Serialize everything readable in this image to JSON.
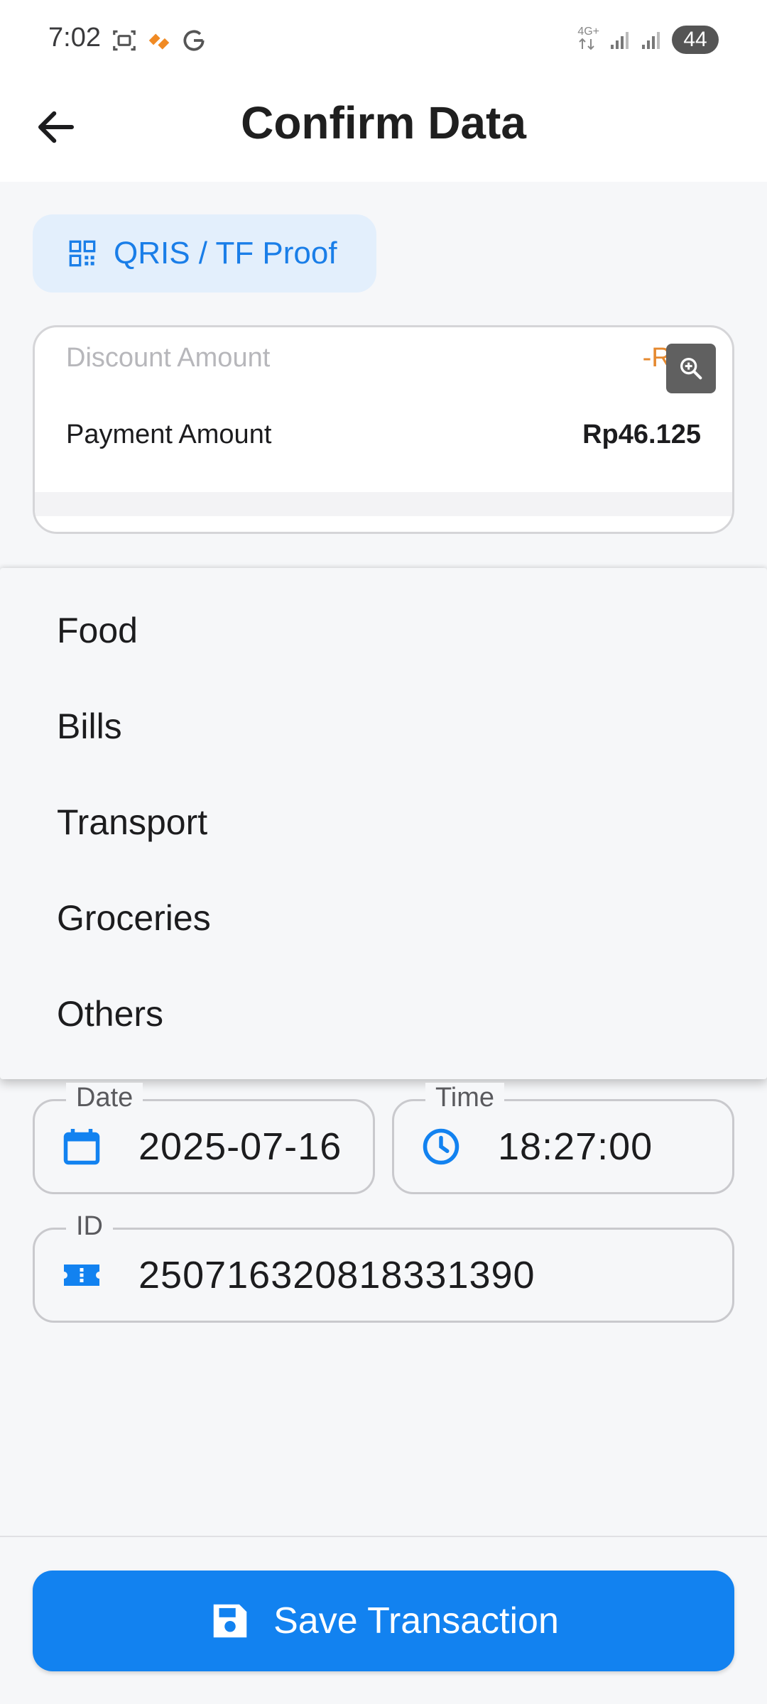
{
  "status_bar": {
    "time": "7:02",
    "network": "4G+",
    "battery": "44"
  },
  "app_bar": {
    "title": "Confirm Data"
  },
  "qris_chip": {
    "label": "QRIS / TF Proof"
  },
  "amount_card": {
    "discount_label": "Discount Amount",
    "discount_value": "-Rp5",
    "payment_label": "Payment Amount",
    "payment_value": "Rp46.125"
  },
  "category_menu": {
    "items": [
      "Food",
      "Bills",
      "Transport",
      "Groceries",
      "Others"
    ]
  },
  "fields": {
    "date": {
      "label": "Date",
      "value": "2025-07-16"
    },
    "time": {
      "label": "Time",
      "value": "18:27:00"
    },
    "id": {
      "label": "ID",
      "value": "250716320818331390"
    }
  },
  "save_button": {
    "label": "Save Transaction"
  },
  "colors": {
    "accent": "#1282f0",
    "chip_bg": "#e3effc",
    "discount": "#e5892f"
  }
}
